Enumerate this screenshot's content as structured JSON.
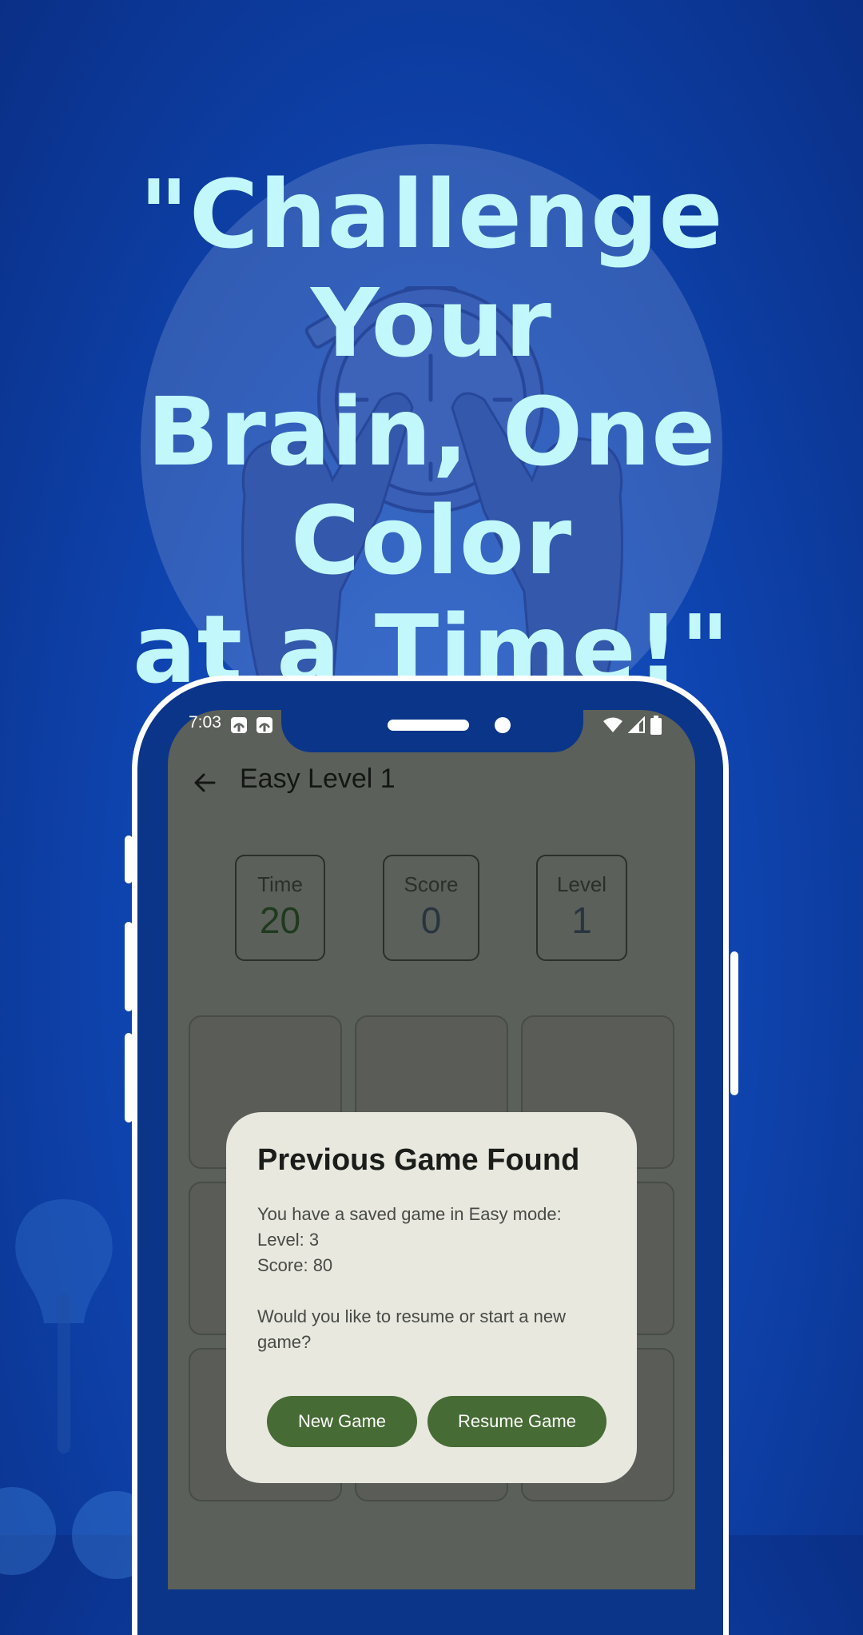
{
  "promo": {
    "headline_line1": "\"Challenge Your",
    "headline_line2": "Brain, One Color",
    "headline_line3": "at a Time!\""
  },
  "status_bar": {
    "time": "7:03"
  },
  "app_bar": {
    "title": "Easy Level 1"
  },
  "stats": {
    "time_label": "Time",
    "time_value": "20",
    "score_label": "Score",
    "score_value": "0",
    "level_label": "Level",
    "level_value": "1"
  },
  "dialog": {
    "title": "Previous Game Found",
    "line1": "You have a saved game in Easy mode:",
    "line2": "Level: 3",
    "line3": "Score: 80",
    "line4": "Would you like to resume or start a new game?",
    "new_game_label": "New Game",
    "resume_game_label": "Resume Game"
  },
  "colors": {
    "background": "#0f46b3",
    "headline": "#c2f7fb",
    "primary_button": "#466b34",
    "dialog_surface": "#e8e8df"
  }
}
